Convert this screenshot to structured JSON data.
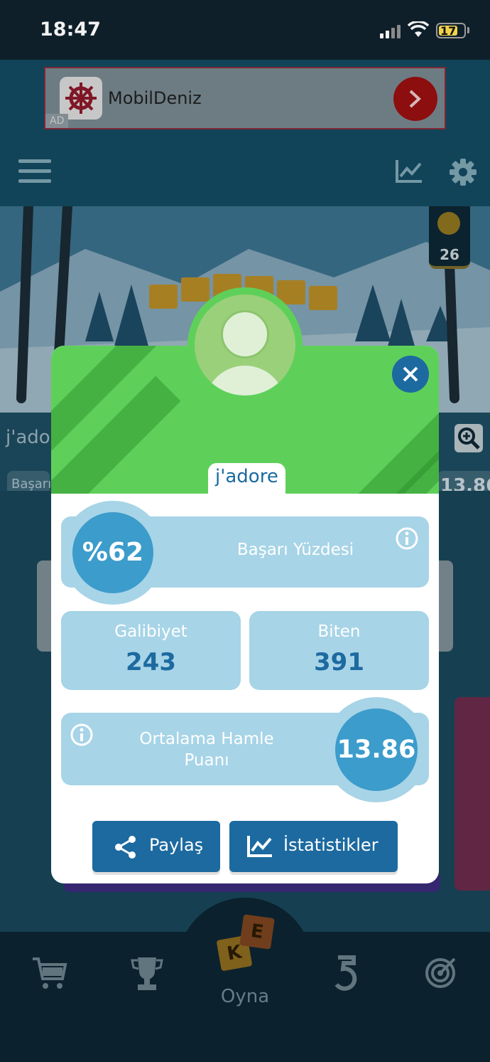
{
  "status_bar": {
    "time": "18:47",
    "battery": "17"
  },
  "ad": {
    "title": "MobilDeniz",
    "label": "AD"
  },
  "background": {
    "coins": "26",
    "username_partial": "j'ado",
    "rate_partial": "Başarı",
    "score_partial": "13.86"
  },
  "nav": {
    "play_label": "Oyna",
    "play_tiles": [
      "K",
      "E"
    ]
  },
  "profile": {
    "username": "j'adore",
    "success_rate": "%62",
    "success_rate_label": "Başarı Yüzdesi",
    "wins_label": "Galibiyet",
    "wins_value": "243",
    "finished_label": "Biten",
    "finished_value": "391",
    "avg_label": "Ortalama Hamle Puanı",
    "avg_value": "13.86",
    "share_label": "Paylaş",
    "stats_label": "İstatistikler"
  },
  "colors": {
    "accent": "#1c6aa0",
    "card": "#a7d4e7",
    "header_green": "#5ed05a",
    "circle": "#3c9ccb"
  }
}
